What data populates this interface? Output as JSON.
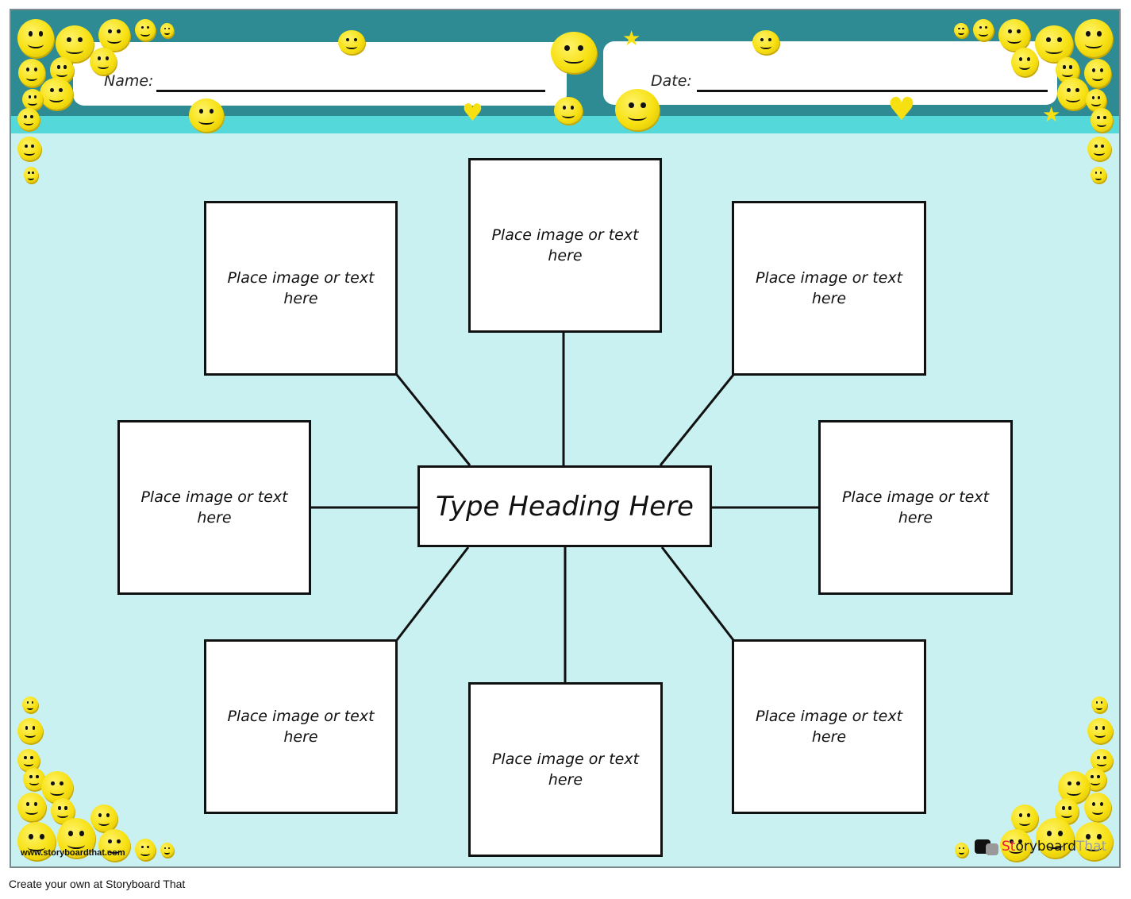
{
  "header": {
    "name_label": "Name:",
    "date_label": "Date:"
  },
  "center": {
    "heading": "Type Heading Here"
  },
  "boxes": [
    {
      "id": "top",
      "text": "Place image or text here"
    },
    {
      "id": "top-left",
      "text": "Place image or text here"
    },
    {
      "id": "top-right",
      "text": "Place image or text here"
    },
    {
      "id": "left",
      "text": "Place image or text here"
    },
    {
      "id": "right",
      "text": "Place image or text here"
    },
    {
      "id": "bottom-left",
      "text": "Place image or text here"
    },
    {
      "id": "bottom",
      "text": "Place image or text here"
    },
    {
      "id": "bottom-right",
      "text": "Place image or text here"
    }
  ],
  "branding": {
    "watermark": "www.storyboardthat.com",
    "logo_story": "St",
    "logo_mid": "oryboard",
    "logo_that": "That",
    "footer": "Create your own at Storyboard That"
  },
  "colors": {
    "background": "#c9f1f2",
    "band_dark": "#2e8b93",
    "band_light": "#55d8da",
    "emoji_yellow": "#f7e011"
  }
}
